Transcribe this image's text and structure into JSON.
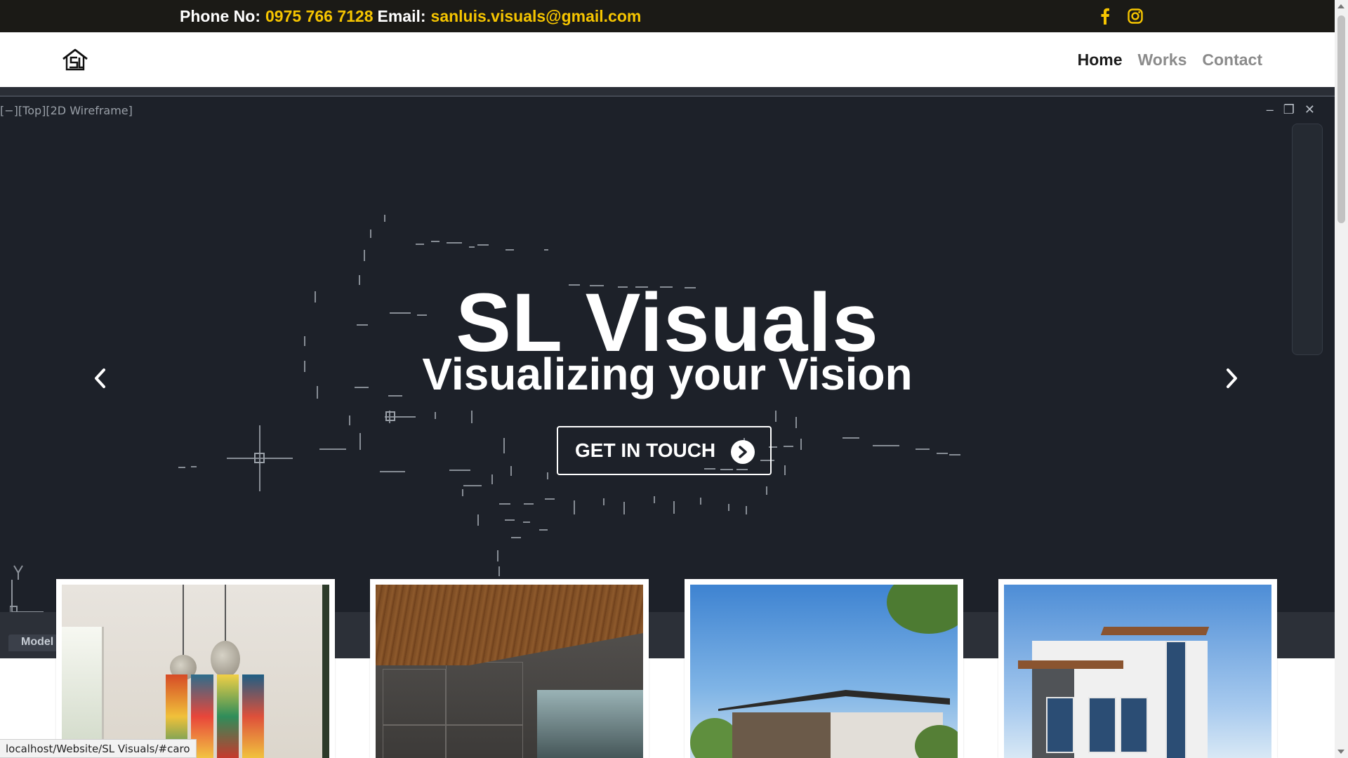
{
  "topbar": {
    "phone_label": "Phone No:",
    "phone": "0975 766 7128",
    "email_label": "Email:",
    "email": "sanluis.visuals@gmail.com",
    "social": [
      "facebook-icon",
      "instagram-icon"
    ],
    "accent_color": "#f6c500"
  },
  "nav": {
    "items": [
      {
        "label": "Home",
        "active": true
      },
      {
        "label": "Works",
        "active": false
      },
      {
        "label": "Contact",
        "active": false
      }
    ]
  },
  "hero": {
    "viewport_label": "[−][Top][2D Wireframe]",
    "title": "SL Visuals",
    "subtitle": "Visualizing your Vision",
    "cta_label": "GET IN TOUCH",
    "model_tab": "Model",
    "axis_label": "Y"
  },
  "cards": [
    {
      "name": "interior-living-room"
    },
    {
      "name": "interior-concrete-room"
    },
    {
      "name": "modern-house-exterior"
    },
    {
      "name": "modern-house-multi-storey"
    }
  ],
  "status": {
    "url": "localhost/Website/SL Visuals/#caro"
  }
}
